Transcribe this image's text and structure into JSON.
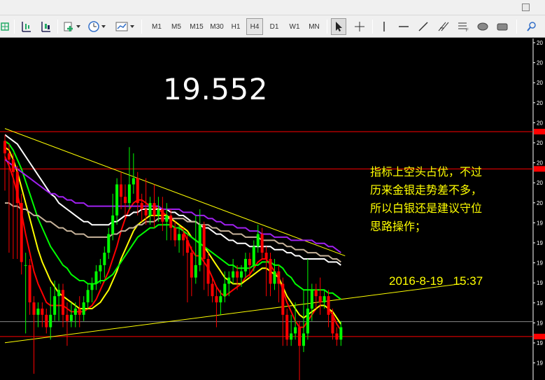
{
  "toolbar": {
    "timeframes": [
      "M1",
      "M5",
      "M15",
      "M30",
      "H1",
      "H4",
      "D1",
      "W1",
      "MN"
    ],
    "active_timeframe": "H4"
  },
  "annotations": {
    "price_label": "19.552",
    "note_line1": "指标上空头占优，不过",
    "note_line2": "历来金银走势差不多，",
    "note_line3": "所以白银还是建议守位",
    "note_line4": "思路操作；",
    "datetime": "2016-8-19   15:37"
  },
  "colors": {
    "background": "#000000",
    "bull_candle": "#00ff00",
    "bear_candle": "#ff0000",
    "ma_red": "#ff0000",
    "ma_yellow": "#ffff00",
    "ma_green": "#00ff00",
    "ma_white": "#ffffff",
    "ma_purple": "#a020f0",
    "ma_gray": "#c8b49b",
    "annotation": "#ffff00",
    "hline": "#ff0000",
    "trendline": "#ffff00"
  },
  "chart_data": {
    "type": "candlestick",
    "instrument": "silver",
    "y_axis_ticks_visible": [
      "20",
      "20",
      "20",
      "20",
      "20",
      "20",
      "20",
      "20",
      "20",
      "19",
      "19",
      "19",
      "19",
      "19",
      "19",
      "19",
      "19"
    ],
    "price_range": [
      19.45,
      20.55
    ],
    "candles": [
      [
        20.18,
        20.22,
        20.24,
        20.06
      ],
      [
        20.16,
        20.18,
        20.21,
        19.86
      ],
      [
        20.12,
        20.16,
        20.18,
        19.84
      ],
      [
        20.02,
        20.12,
        20.14,
        19.84
      ],
      [
        19.83,
        20.02,
        20.05,
        19.79
      ],
      [
        19.82,
        19.82,
        19.86,
        19.6
      ],
      [
        19.7,
        19.82,
        19.84,
        19.66
      ],
      [
        19.66,
        19.7,
        19.72,
        19.47
      ],
      [
        19.68,
        19.66,
        19.7,
        19.62
      ],
      [
        19.66,
        19.68,
        19.7,
        19.62
      ],
      [
        19.62,
        19.66,
        19.68,
        19.6
      ],
      [
        19.66,
        19.62,
        19.75,
        19.58
      ],
      [
        19.72,
        19.66,
        19.77,
        19.64
      ],
      [
        19.74,
        19.72,
        19.76,
        19.64
      ],
      [
        19.66,
        19.74,
        19.76,
        19.62
      ],
      [
        19.64,
        19.66,
        19.7,
        19.56
      ],
      [
        19.66,
        19.64,
        19.7,
        19.62
      ],
      [
        19.68,
        19.66,
        19.7,
        19.62
      ],
      [
        19.66,
        19.68,
        19.72,
        19.62
      ],
      [
        19.7,
        19.66,
        19.72,
        19.64
      ],
      [
        19.74,
        19.7,
        19.76,
        19.68
      ],
      [
        19.76,
        19.74,
        19.78,
        19.7
      ],
      [
        19.8,
        19.76,
        19.82,
        19.74
      ],
      [
        19.82,
        19.8,
        19.84,
        19.76
      ],
      [
        19.86,
        19.82,
        19.88,
        19.78
      ],
      [
        19.92,
        19.86,
        19.94,
        19.84
      ],
      [
        19.98,
        19.92,
        20.05,
        19.9
      ],
      [
        20.08,
        19.98,
        20.1,
        19.95
      ],
      [
        20.04,
        20.08,
        20.12,
        20.0
      ],
      [
        20.02,
        20.04,
        20.08,
        19.97
      ],
      [
        20.08,
        20.02,
        20.2,
        20.0
      ],
      [
        20.1,
        20.08,
        20.18,
        20.05
      ],
      [
        20.02,
        20.1,
        20.12,
        19.98
      ],
      [
        20.0,
        20.02,
        20.05,
        19.96
      ],
      [
        19.98,
        20.0,
        20.1,
        19.95
      ],
      [
        20.02,
        19.98,
        20.04,
        19.95
      ],
      [
        19.98,
        20.02,
        20.08,
        19.94
      ],
      [
        20.0,
        19.98,
        20.04,
        19.96
      ],
      [
        19.96,
        20.0,
        20.04,
        19.93
      ],
      [
        19.98,
        19.96,
        20.02,
        19.9
      ],
      [
        19.94,
        19.98,
        20.0,
        19.9
      ],
      [
        19.9,
        19.94,
        19.96,
        19.88
      ],
      [
        19.92,
        19.9,
        19.95,
        19.86
      ],
      [
        19.9,
        19.92,
        19.94,
        19.85
      ],
      [
        19.86,
        19.9,
        19.92,
        19.7
      ],
      [
        19.78,
        19.86,
        19.88,
        19.72
      ],
      [
        19.82,
        19.78,
        19.98,
        19.76
      ],
      [
        19.95,
        19.82,
        20.0,
        19.8
      ],
      [
        19.84,
        19.95,
        19.96,
        19.74
      ],
      [
        19.76,
        19.84,
        19.86,
        19.72
      ],
      [
        19.72,
        19.76,
        19.78,
        19.7
      ],
      [
        19.7,
        19.72,
        19.75,
        19.62
      ],
      [
        19.72,
        19.7,
        19.74,
        19.66
      ],
      [
        19.76,
        19.72,
        19.8,
        19.7
      ],
      [
        19.78,
        19.76,
        19.8,
        19.72
      ],
      [
        19.8,
        19.78,
        19.84,
        19.76
      ],
      [
        19.78,
        19.8,
        19.82,
        19.74
      ],
      [
        19.8,
        19.78,
        19.82,
        19.75
      ],
      [
        19.84,
        19.8,
        19.86,
        19.78
      ],
      [
        19.82,
        19.84,
        19.86,
        19.78
      ],
      [
        19.88,
        19.82,
        19.9,
        19.8
      ],
      [
        19.92,
        19.88,
        19.95,
        19.86
      ],
      [
        19.86,
        19.92,
        19.94,
        19.84
      ],
      [
        19.84,
        19.86,
        19.88,
        19.72
      ],
      [
        19.76,
        19.84,
        19.86,
        19.72
      ],
      [
        19.8,
        19.76,
        19.84,
        19.74
      ],
      [
        19.76,
        19.8,
        19.82,
        19.7
      ],
      [
        19.66,
        19.76,
        19.78,
        19.56
      ],
      [
        19.58,
        19.66,
        19.68,
        19.56
      ],
      [
        19.6,
        19.58,
        19.66,
        19.56
      ],
      [
        19.62,
        19.6,
        19.7,
        19.58
      ],
      [
        19.56,
        19.62,
        19.64,
        19.4
      ],
      [
        19.6,
        19.56,
        19.74,
        19.54
      ],
      [
        19.68,
        19.6,
        19.84,
        19.58
      ],
      [
        19.74,
        19.68,
        19.76,
        19.64
      ],
      [
        19.72,
        19.74,
        19.76,
        19.68
      ],
      [
        19.7,
        19.72,
        19.78,
        19.66
      ],
      [
        19.72,
        19.7,
        19.74,
        19.68
      ],
      [
        19.66,
        19.72,
        19.74,
        19.62
      ],
      [
        19.6,
        19.66,
        19.68,
        19.58
      ],
      [
        19.58,
        19.6,
        19.62,
        19.56
      ],
      [
        19.62,
        19.58,
        19.64,
        19.56
      ]
    ],
    "moving_averages": [
      {
        "color": "#ff0000",
        "values": [
          20.17,
          20.14,
          20.1,
          20.05,
          19.99,
          19.92,
          19.86,
          19.8,
          19.76,
          19.73,
          19.7,
          19.69,
          19.69,
          19.69,
          19.69,
          19.68,
          19.67,
          19.67,
          19.67,
          19.67,
          19.68,
          19.69,
          19.71,
          19.74,
          19.77,
          19.8,
          19.84,
          19.88,
          19.93,
          19.97,
          20.0,
          20.02,
          20.03,
          20.03,
          20.02,
          20.01,
          20.01,
          20.0,
          19.99,
          19.98,
          19.97,
          19.96,
          19.95,
          19.93,
          19.9,
          19.87,
          19.85,
          19.85,
          19.83,
          19.81,
          19.78,
          19.75,
          19.73,
          19.72,
          19.73,
          19.74,
          19.75,
          19.76,
          19.78,
          19.79,
          19.81,
          19.83,
          19.84,
          19.84,
          19.82,
          19.8,
          19.78,
          19.74,
          19.7,
          19.67,
          19.64,
          19.62,
          19.62,
          19.64,
          19.66,
          19.68,
          19.69,
          19.69,
          19.68,
          19.66,
          19.63,
          19.61
        ]
      },
      {
        "color": "#ffff00",
        "values": [
          20.2,
          20.19,
          20.16,
          20.12,
          20.07,
          20.02,
          19.97,
          19.92,
          19.87,
          19.83,
          19.8,
          19.77,
          19.75,
          19.73,
          19.72,
          19.71,
          19.7,
          19.69,
          19.68,
          19.68,
          19.68,
          19.68,
          19.69,
          19.7,
          19.72,
          19.74,
          19.77,
          19.8,
          19.84,
          19.87,
          19.9,
          19.93,
          19.95,
          19.96,
          19.97,
          19.98,
          19.98,
          19.98,
          19.98,
          19.98,
          19.97,
          19.96,
          19.95,
          19.94,
          19.93,
          19.91,
          19.9,
          19.89,
          19.88,
          19.86,
          19.84,
          19.82,
          19.8,
          19.78,
          19.77,
          19.76,
          19.76,
          19.76,
          19.77,
          19.78,
          19.79,
          19.8,
          19.81,
          19.81,
          19.8,
          19.79,
          19.78,
          19.75,
          19.72,
          19.7,
          19.68,
          19.66,
          19.65,
          19.66,
          19.67,
          19.68,
          19.69,
          19.69,
          19.68,
          19.67,
          19.65,
          19.63
        ]
      },
      {
        "color": "#00ff00",
        "values": [
          20.22,
          20.21,
          20.19,
          20.16,
          20.13,
          20.09,
          20.05,
          20.01,
          19.97,
          19.94,
          19.91,
          19.88,
          19.86,
          19.84,
          19.82,
          19.81,
          19.79,
          19.78,
          19.77,
          19.77,
          19.76,
          19.76,
          19.76,
          19.77,
          19.77,
          19.78,
          19.79,
          19.81,
          19.83,
          19.85,
          19.87,
          19.89,
          19.91,
          19.92,
          19.93,
          19.94,
          19.94,
          19.95,
          19.95,
          19.95,
          19.95,
          19.94,
          19.94,
          19.93,
          19.92,
          19.91,
          19.9,
          19.89,
          19.88,
          19.87,
          19.86,
          19.85,
          19.84,
          19.83,
          19.82,
          19.82,
          19.81,
          19.81,
          19.81,
          19.81,
          19.82,
          19.82,
          19.83,
          19.83,
          19.83,
          19.82,
          19.82,
          19.81,
          19.79,
          19.78,
          19.76,
          19.75,
          19.74,
          19.74,
          19.74,
          19.74,
          19.74,
          19.74,
          19.73,
          19.73,
          19.72,
          19.71
        ]
      },
      {
        "color": "#ffffff",
        "values": [
          20.24,
          20.23,
          20.22,
          20.21,
          20.19,
          20.17,
          20.15,
          20.13,
          20.11,
          20.09,
          20.07,
          20.05,
          20.04,
          20.02,
          20.01,
          20.0,
          19.99,
          19.98,
          19.97,
          19.96,
          19.96,
          19.95,
          19.95,
          19.95,
          19.95,
          19.95,
          19.96,
          19.96,
          19.97,
          19.98,
          19.98,
          19.99,
          19.99,
          20.0,
          20.0,
          20.0,
          20.0,
          20.0,
          20.0,
          20.0,
          19.99,
          19.99,
          19.98,
          19.98,
          19.97,
          19.96,
          19.96,
          19.95,
          19.94,
          19.94,
          19.93,
          19.92,
          19.92,
          19.91,
          19.9,
          19.9,
          19.89,
          19.89,
          19.89,
          19.88,
          19.88,
          19.88,
          19.88,
          19.88,
          19.88,
          19.87,
          19.87,
          19.87,
          19.86,
          19.86,
          19.85,
          19.85,
          19.84,
          19.84,
          19.84,
          19.84,
          19.84,
          19.84,
          19.83,
          19.83,
          19.83,
          19.82
        ]
      },
      {
        "color": "#a020f0",
        "values": [
          20.16,
          20.15,
          20.14,
          20.13,
          20.12,
          20.11,
          20.1,
          20.09,
          20.08,
          20.07,
          20.06,
          20.05,
          20.05,
          20.04,
          20.04,
          20.03,
          20.03,
          20.02,
          20.02,
          20.02,
          20.01,
          20.01,
          20.01,
          20.01,
          20.01,
          20.01,
          20.01,
          20.01,
          20.01,
          20.01,
          20.01,
          20.01,
          20.01,
          20.01,
          20.01,
          20.01,
          20.01,
          20.01,
          20.0,
          20.0,
          20.0,
          20.0,
          20.0,
          19.99,
          19.99,
          19.99,
          19.98,
          19.98,
          19.98,
          19.97,
          19.97,
          19.96,
          19.96,
          19.95,
          19.95,
          19.95,
          19.94,
          19.94,
          19.94,
          19.93,
          19.93,
          19.93,
          19.92,
          19.92,
          19.92,
          19.91,
          19.91,
          19.91,
          19.91,
          19.9,
          19.9,
          19.9,
          19.9,
          19.9,
          19.9,
          19.89,
          19.89,
          19.89,
          19.88,
          19.88,
          19.87,
          19.86
        ]
      },
      {
        "color": "#c8b49b",
        "values": [
          20.02,
          20.02,
          20.01,
          20.01,
          20.0,
          20.0,
          19.99,
          19.98,
          19.98,
          19.97,
          19.96,
          19.96,
          19.95,
          19.94,
          19.94,
          19.93,
          19.93,
          19.92,
          19.92,
          19.92,
          19.91,
          19.91,
          19.91,
          19.91,
          19.91,
          19.91,
          19.92,
          19.92,
          19.93,
          19.93,
          19.94,
          19.94,
          19.95,
          19.95,
          19.96,
          19.96,
          19.96,
          19.97,
          19.97,
          19.97,
          19.97,
          19.97,
          19.97,
          19.97,
          19.96,
          19.96,
          19.96,
          19.95,
          19.95,
          19.95,
          19.94,
          19.94,
          19.93,
          19.93,
          19.93,
          19.92,
          19.92,
          19.92,
          19.91,
          19.91,
          19.91,
          19.91,
          19.9,
          19.9,
          19.9,
          19.9,
          19.89,
          19.89,
          19.88,
          19.88,
          19.87,
          19.87,
          19.87,
          19.86,
          19.86,
          19.86,
          19.85,
          19.85,
          19.85,
          19.84,
          19.84,
          19.83
        ]
      }
    ],
    "horizontal_lines": [
      20.25,
      20.13,
      19.59
    ],
    "trendlines": [
      {
        "from": [
          0,
          20.26
        ],
        "to": [
          82,
          19.85
        ]
      },
      {
        "from": [
          0,
          19.57
        ],
        "to": [
          110,
          19.76
        ]
      }
    ]
  }
}
